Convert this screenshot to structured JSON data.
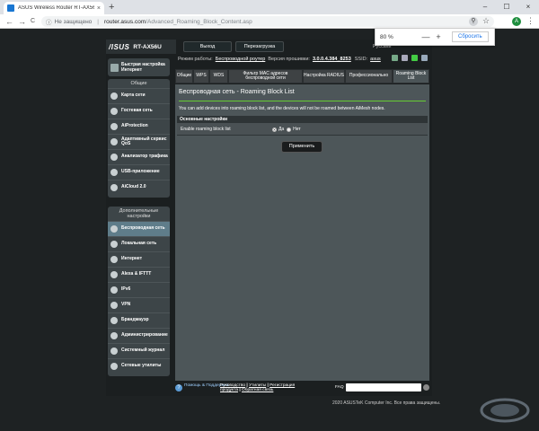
{
  "browser": {
    "tab_title": "ASUS Wireless Router RT-AX56U - Advanced...",
    "close_tab": "×",
    "new_tab": "+",
    "window_controls": [
      "–",
      "☐",
      "×"
    ],
    "nav_back": "←",
    "nav_forward": "→",
    "nav_reload": "C",
    "lock": "ⓘ",
    "insecure": "Не защищено",
    "url_separator": "|",
    "url_host": "router.asus.com",
    "url_path": "/Advanced_Roaming_Block_Content.asp",
    "zoom_icon": "⚲",
    "star": "☆",
    "profile_letter": "A",
    "menu": "⋮",
    "zoom_popup": {
      "percent": "80 %",
      "minus": "—",
      "plus": "+",
      "reset": "Сбросить"
    }
  },
  "router": {
    "brand": "/ISUS",
    "model": "RT-AX56U",
    "logout": "Выход",
    "reboot": "Перезагрузка",
    "language": "Русский",
    "status": {
      "mode_label": "Режим работы:",
      "mode_value": "Беспроводной роутер",
      "fw_label": "Версия прошивки:",
      "fw_value": "3.0.0.4.384_8253",
      "ssid_label": "SSID:",
      "ssid_value": "asus"
    },
    "quick_setup": "Быстрая настройка Интернет",
    "general": {
      "header": "Общие",
      "items": [
        "Карта сети",
        "Гостевая сеть",
        "AiProtection",
        "Адаптивный сервис QoS",
        "Анализатор трафика",
        "USB-приложение",
        "AiCloud 2.0"
      ]
    },
    "advanced": {
      "header": "Дополнительные настройки",
      "items": [
        "Беспроводная сеть",
        "Локальная сеть",
        "Интернет",
        "Alexa & IFTTT",
        "IPv6",
        "VPN",
        "Брандмауэр",
        "Администрирование",
        "Системный журнал",
        "Сетевые утилиты"
      ],
      "active_index": 0
    },
    "tabs": [
      "Общие",
      "WPS",
      "WDS",
      "Фильтр MAC адресов беспроводной сети",
      "Настройка RADIUS",
      "Профессионально",
      "Roaming Block List"
    ],
    "active_tab": 6,
    "content": {
      "title": "Беспроводная сеть - Roaming Block List",
      "description": "You can add devices into roaming block list, and the devices will not be roamed between AiMesh nodes.",
      "section": "Основные настройки",
      "row_label": "Enable roaming block list",
      "opt_yes": "Да",
      "opt_no": "Нет",
      "selected": "yes",
      "apply": "Применить"
    },
    "footer": {
      "help_icon": "?",
      "help": "Помощь & Поддержка",
      "links_line1": [
        "Руководство",
        "Утилиты",
        "Регистрация"
      ],
      "links_line2": [
        "продукта",
        "Обратная связь"
      ],
      "link_separator": "|",
      "faq": "FAQ"
    },
    "copyright": "2020 ASUSTeK Computer Inc. Все права защищены."
  }
}
